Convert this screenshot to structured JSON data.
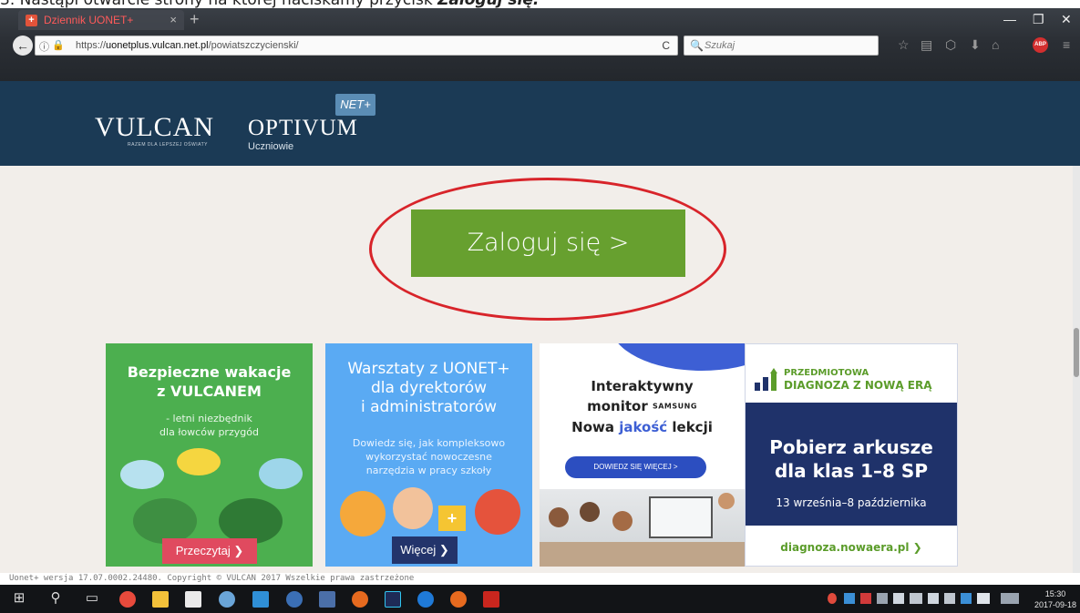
{
  "caption": {
    "prefix": "3. Nastąpi otwarcie strony na której naciskamy przycisk ",
    "emphasis": "Zaloguj się."
  },
  "browser": {
    "tab_title": "Dziennik UONET+",
    "tab_close": "×",
    "new_tab": "+",
    "url_host": "uonetplus.vulcan.net.pl",
    "url_prefix": "https://",
    "url_path": "/powiatszczycienski/",
    "search_placeholder": "Szukaj",
    "back_glyph": "←",
    "info_glyph": "ⓘ",
    "lock_glyph": "🔒",
    "reload_glyph": "C",
    "search_glyph": "🔍",
    "toolbar_icons": [
      "☆",
      "▤",
      "⬡",
      "⬇",
      "⌂",
      "≡"
    ],
    "adblock_label": "ABP",
    "window_controls": [
      "—",
      "❐",
      "✕"
    ]
  },
  "site": {
    "vulcan_logo": "VULCAN",
    "vulcan_tagline": "RAZEM DLA LEPSZEJ OŚWIATY",
    "optivum_logo": "OPTIVUM",
    "net_badge": "NET+",
    "product_sub": "Uczniowie"
  },
  "login_button": "Zaloguj się >",
  "banners": {
    "vacation": {
      "title_line1": "Bezpieczne wakacje",
      "title_line2": "z VULCANEM",
      "sub_line1": "- letni niezbędnik",
      "sub_line2": "dla łowców przygód",
      "button": "Przeczytaj ❯"
    },
    "workshops": {
      "title_line1": "Warsztaty z UONET+",
      "title_line2": "dla dyrektorów",
      "title_line3": "i administratorów",
      "sub_line1": "Dowiedz się, jak kompleksowo",
      "sub_line2": "wykorzystać nowoczesne",
      "sub_line3": "narzędzia w pracy szkoły",
      "button": "Więcej ❯",
      "plus": "+"
    },
    "monitor": {
      "line1": "Interaktywny",
      "line2_word": "monitor",
      "line2_brand": "SAMSUNG",
      "line3_a": "Nowa ",
      "line3_b": "jakość",
      "line3_c": " lekcji",
      "button": "DOWIEDZ SIĘ WIĘCEJ  >"
    },
    "diagnoza": {
      "logo_line1": "PRZEDMIOTOWA",
      "logo_line2": "DIAGNOZA Z NOWĄ ERĄ",
      "title_line1": "Pobierz arkusze",
      "title_line2": "dla klas 1–8 SP",
      "dates": "13 września–8 października",
      "link": "diagnoza.nowaera.pl ❯"
    }
  },
  "footer": "Uonet+ wersja 17.07.0002.24480. Copyright © VULCAN 2017 Wszelkie prawa zastrzeżone",
  "taskbar": {
    "time": "15:30",
    "date": "2017-09-18",
    "start_glyph": "⊞",
    "search_glyph": "⚲",
    "taskview_glyph": "▭"
  }
}
